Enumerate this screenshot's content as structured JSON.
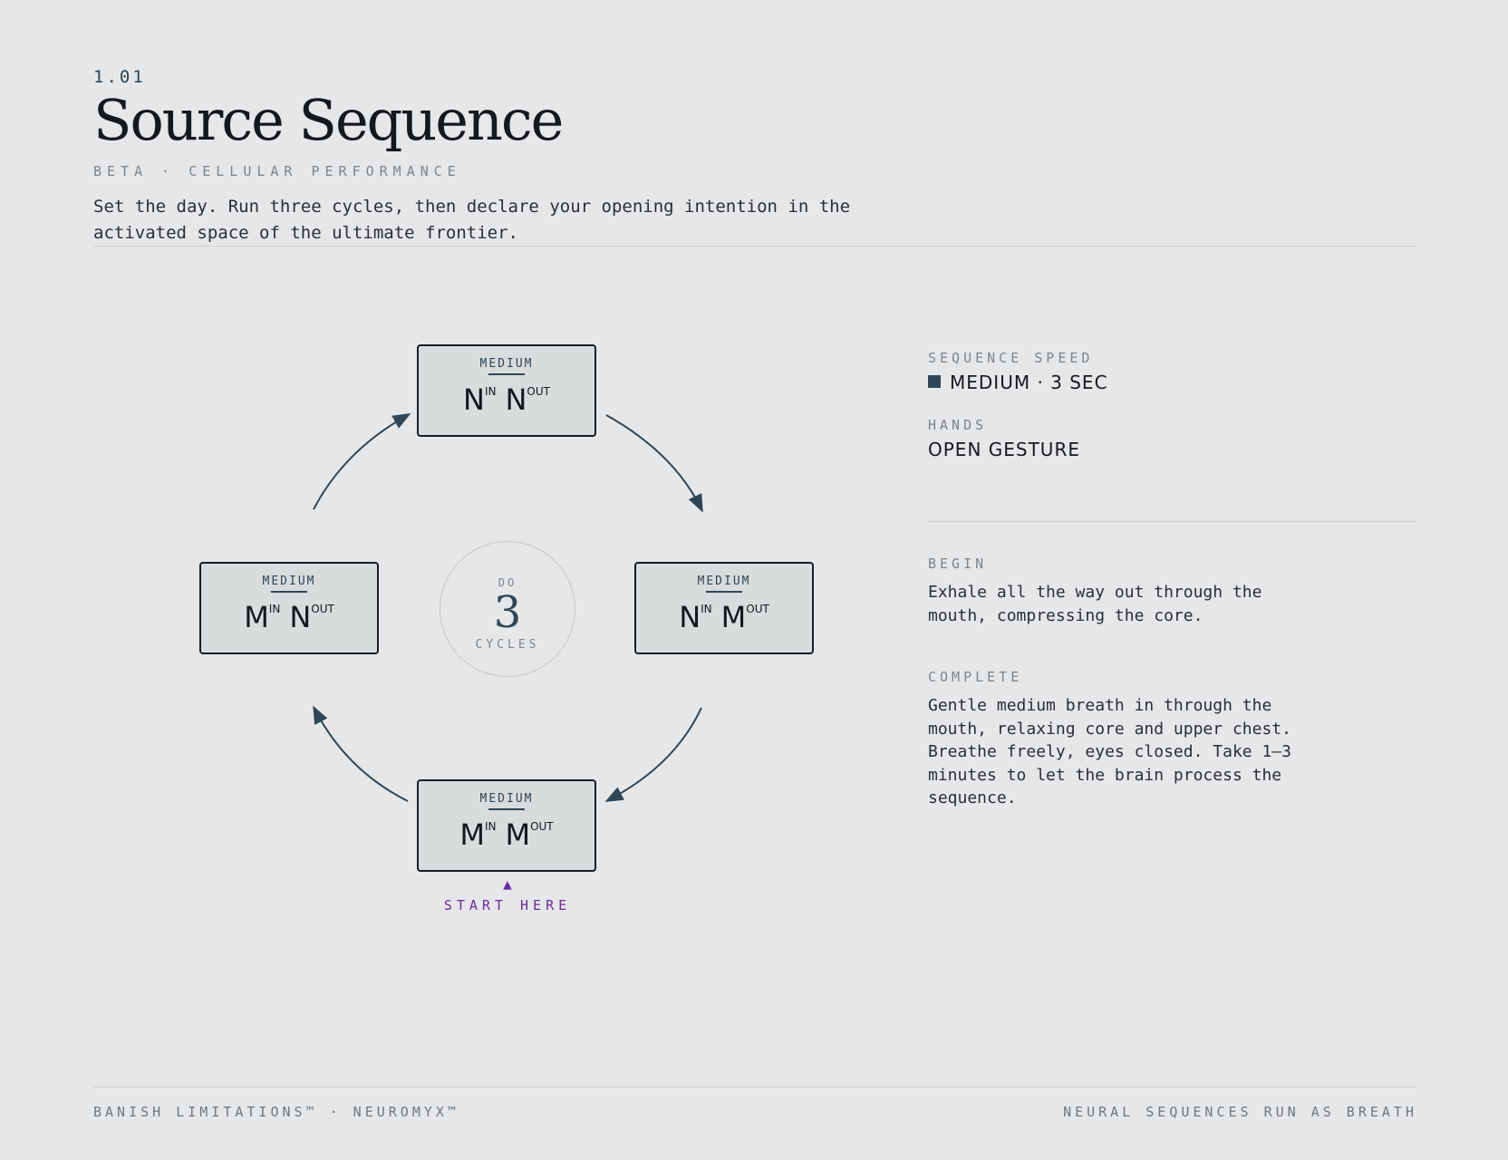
{
  "header": {
    "version": "1.01",
    "title": "Source Sequence",
    "subtitle": "BETA · CELLULAR PERFORMANCE",
    "intro": "Set the day. Run three cycles, then declare your opening intention in the activated space of the ultimate frontier."
  },
  "diagram": {
    "boxes": {
      "top": {
        "speed": "MEDIUM",
        "in": "N",
        "in_sup": "IN",
        "out": "N",
        "out_sup": "OUT"
      },
      "right": {
        "speed": "MEDIUM",
        "in": "N",
        "in_sup": "IN",
        "out": "M",
        "out_sup": "OUT"
      },
      "bottom": {
        "speed": "MEDIUM",
        "in": "M",
        "in_sup": "IN",
        "out": "M",
        "out_sup": "OUT"
      },
      "left": {
        "speed": "MEDIUM",
        "in": "M",
        "in_sup": "IN",
        "out": "N",
        "out_sup": "OUT"
      }
    },
    "center": {
      "do": "DO",
      "count": "3",
      "cycles": "CYCLES"
    },
    "start": {
      "marker": "▲",
      "label": "START HERE"
    },
    "colors": {
      "accent": "#2f4656",
      "start": "#6b2aa3",
      "box_border": "#1a1d21"
    },
    "arrow_direction": "clockwise"
  },
  "side": {
    "speed_label": "SEQUENCE SPEED",
    "speed_value": "MEDIUM · 3 SEC",
    "hands_label": "HANDS",
    "hands_value": "OPEN GESTURE",
    "begin_label": "BEGIN",
    "begin_text": "Exhale all the way out through the mouth, compressing the core.",
    "complete_label": "COMPLETE",
    "complete_text": "Gentle medium breath in through the mouth, relaxing core and upper chest. Breathe freely, eyes closed. Take 1–3 minutes to let the brain process the sequence."
  },
  "footer": {
    "left": "BANISH LIMITATIONS™ · NEUROMYX™",
    "right": "NEURAL SEQUENCES RUN AS BREATH"
  }
}
